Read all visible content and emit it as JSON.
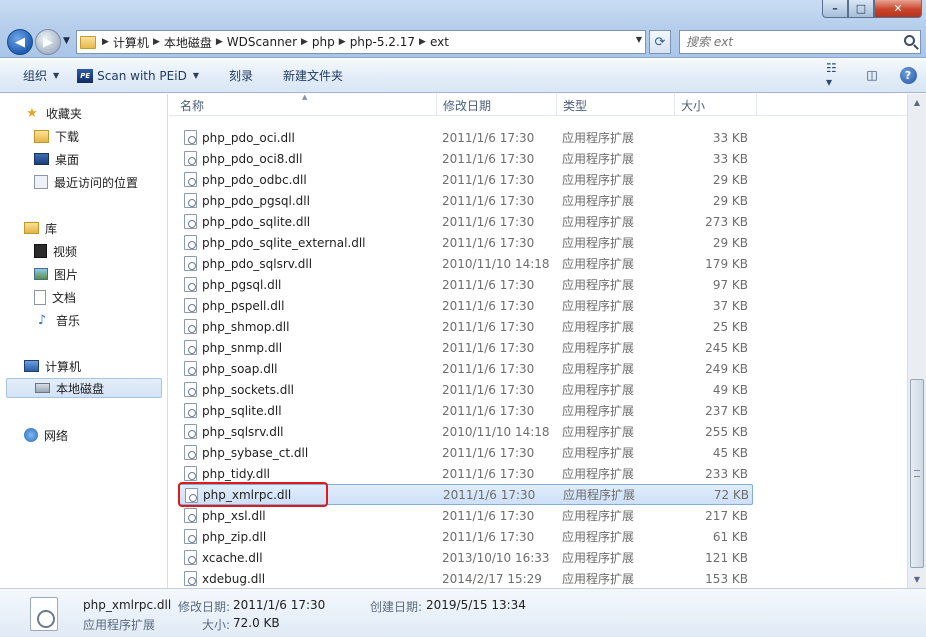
{
  "address": {
    "crumbs": [
      "计算机",
      "本地磁盘",
      "WDScanner",
      "php",
      "php-5.2.17",
      "ext"
    ]
  },
  "search": {
    "placeholder": "搜索 ext"
  },
  "toolbar": {
    "organize": "组织",
    "peid": "Scan with PEiD",
    "burn": "刻录",
    "new_folder": "新建文件夹"
  },
  "nav": {
    "favorites": "收藏夹",
    "downloads": "下载",
    "desktop": "桌面",
    "recent": "最近访问的位置",
    "libraries": "库",
    "videos": "视频",
    "pictures": "图片",
    "documents": "文档",
    "music": "音乐",
    "computer": "计算机",
    "local_disk": "本地磁盘",
    "network": "网络"
  },
  "columns": {
    "name": "名称",
    "date": "修改日期",
    "type": "类型",
    "size": "大小"
  },
  "files": [
    {
      "name": "php_pdo_oci.dll",
      "date": "2011/1/6 17:30",
      "type": "应用程序扩展",
      "size": "33 KB"
    },
    {
      "name": "php_pdo_oci8.dll",
      "date": "2011/1/6 17:30",
      "type": "应用程序扩展",
      "size": "33 KB"
    },
    {
      "name": "php_pdo_odbc.dll",
      "date": "2011/1/6 17:30",
      "type": "应用程序扩展",
      "size": "29 KB"
    },
    {
      "name": "php_pdo_pgsql.dll",
      "date": "2011/1/6 17:30",
      "type": "应用程序扩展",
      "size": "29 KB"
    },
    {
      "name": "php_pdo_sqlite.dll",
      "date": "2011/1/6 17:30",
      "type": "应用程序扩展",
      "size": "273 KB"
    },
    {
      "name": "php_pdo_sqlite_external.dll",
      "date": "2011/1/6 17:30",
      "type": "应用程序扩展",
      "size": "29 KB"
    },
    {
      "name": "php_pdo_sqlsrv.dll",
      "date": "2010/11/10 14:18",
      "type": "应用程序扩展",
      "size": "179 KB"
    },
    {
      "name": "php_pgsql.dll",
      "date": "2011/1/6 17:30",
      "type": "应用程序扩展",
      "size": "97 KB"
    },
    {
      "name": "php_pspell.dll",
      "date": "2011/1/6 17:30",
      "type": "应用程序扩展",
      "size": "37 KB"
    },
    {
      "name": "php_shmop.dll",
      "date": "2011/1/6 17:30",
      "type": "应用程序扩展",
      "size": "25 KB"
    },
    {
      "name": "php_snmp.dll",
      "date": "2011/1/6 17:30",
      "type": "应用程序扩展",
      "size": "245 KB"
    },
    {
      "name": "php_soap.dll",
      "date": "2011/1/6 17:30",
      "type": "应用程序扩展",
      "size": "249 KB"
    },
    {
      "name": "php_sockets.dll",
      "date": "2011/1/6 17:30",
      "type": "应用程序扩展",
      "size": "49 KB"
    },
    {
      "name": "php_sqlite.dll",
      "date": "2011/1/6 17:30",
      "type": "应用程序扩展",
      "size": "237 KB"
    },
    {
      "name": "php_sqlsrv.dll",
      "date": "2010/11/10 14:18",
      "type": "应用程序扩展",
      "size": "255 KB"
    },
    {
      "name": "php_sybase_ct.dll",
      "date": "2011/1/6 17:30",
      "type": "应用程序扩展",
      "size": "45 KB"
    },
    {
      "name": "php_tidy.dll",
      "date": "2011/1/6 17:30",
      "type": "应用程序扩展",
      "size": "233 KB"
    },
    {
      "name": "php_xmlrpc.dll",
      "date": "2011/1/6 17:30",
      "type": "应用程序扩展",
      "size": "72 KB"
    },
    {
      "name": "php_xsl.dll",
      "date": "2011/1/6 17:30",
      "type": "应用程序扩展",
      "size": "217 KB"
    },
    {
      "name": "php_zip.dll",
      "date": "2011/1/6 17:30",
      "type": "应用程序扩展",
      "size": "61 KB"
    },
    {
      "name": "xcache.dll",
      "date": "2013/10/10 16:33",
      "type": "应用程序扩展",
      "size": "121 KB"
    },
    {
      "name": "xdebug.dll",
      "date": "2014/2/17 15:29",
      "type": "应用程序扩展",
      "size": "153 KB"
    }
  ],
  "details": {
    "filename": "php_xmlrpc.dll",
    "type": "应用程序扩展",
    "modified_label": "修改日期:",
    "modified": "2011/1/6 17:30",
    "size_label": "大小:",
    "size": "72.0 KB",
    "created_label": "创建日期:",
    "created": "2019/5/15 13:34"
  },
  "colors": {
    "selection": "#cde0f7",
    "highlight_outline": "#e01919",
    "accent": "#1f5db4"
  },
  "icons": {
    "view": "view-options-icon",
    "preview": "preview-pane-icon",
    "help": "help-icon"
  }
}
